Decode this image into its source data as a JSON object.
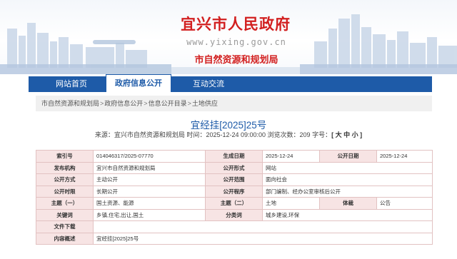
{
  "header": {
    "site_title": "宜兴市人民政府",
    "site_url": "www.yixing.gov.cn",
    "department": "市自然资源和规划局"
  },
  "nav": {
    "items": [
      {
        "label": "网站首页",
        "active": false
      },
      {
        "label": "政府信息公开",
        "active": true
      },
      {
        "label": "互动交流",
        "active": false
      }
    ]
  },
  "breadcrumb": [
    "市自然资源和规划局",
    "政府信息公开",
    "信息公开目录",
    "土地供应"
  ],
  "breadcrumb_separator": ">",
  "document": {
    "title": "宜经挂[2025]25号",
    "source_label": "来源：",
    "source": "宜兴市自然资源和规划局",
    "time_label": "时间：",
    "time": "2025-12-24 09:00:00",
    "views_label": "浏览次数：",
    "views": "209",
    "font_size_label": "字号：",
    "font_size_options": "[ 大 中 小 ]"
  },
  "info_table": {
    "labels": {
      "index_no": "索引号",
      "publish_org": "发布机构",
      "publish_method": "公开方式",
      "period": "公开时限",
      "subject1": "主题（一）",
      "keywords": "关键词",
      "doc_no": "文件下载",
      "summary": "内容概述",
      "gen_date": "生成日期",
      "form": "公开形式",
      "scope": "公开范围",
      "procedure": "公开程序",
      "subject2": "主题（二）",
      "category": "分类词",
      "pub_date": "公开日期",
      "genre": "体裁"
    },
    "values": {
      "index_no": "014046317/2025-07770",
      "publish_org": "宜兴市自然资源和规划局",
      "publish_method": "主动公开",
      "period": "长期公开",
      "subject1": "国土资源、能源",
      "keywords": "乡镇,住宅,出让,国土",
      "doc_no": "",
      "summary": "宜经挂[2025]25号",
      "gen_date": "2025-12-24",
      "form": "网站",
      "scope": "面向社会",
      "procedure": "部门编制、经办公室审核后公开",
      "subject2": "土地",
      "category": "城乡建设,环保",
      "pub_date": "2025-12-24",
      "genre": "公告"
    }
  },
  "colors": {
    "brand_red": "#d21f1f",
    "nav_blue": "#1e5ba8",
    "label_bg": "#f7e4e4",
    "border": "#e2c2c2"
  }
}
